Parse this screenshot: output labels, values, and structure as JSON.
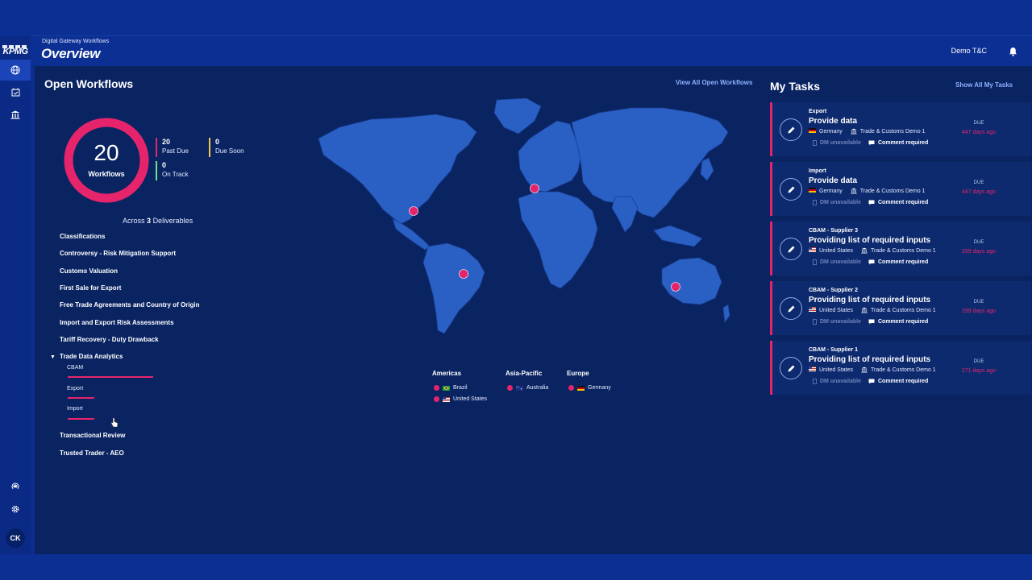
{
  "sidebar": {
    "logo": "KPMG",
    "avatar": "CK",
    "icons": [
      "globe-icon",
      "calendar-check-icon",
      "bank-icon",
      "broadcast-icon",
      "gear-icon"
    ]
  },
  "header": {
    "subtitle": "Digital Gateway Workflows",
    "title": "Overview",
    "user": "Demo T&C"
  },
  "open_workflows": {
    "title": "Open Workflows",
    "view_all": "View All Open Workflows",
    "total": "20",
    "total_label": "Workflows",
    "stats": [
      {
        "num": "20",
        "label": "Past Due",
        "color": "#e6246c"
      },
      {
        "num": "0",
        "label": "Due Soon",
        "color": "#f2c94c"
      },
      {
        "num": "0",
        "label": "On Track",
        "color": "#6fe08a"
      }
    ],
    "across_prefix": "Across",
    "across_count": "3",
    "across_suffix": "Deliverables",
    "deliverables": [
      "Classifications",
      "Controversy - Risk Mitigation Support",
      "Customs Valuation",
      "First Sale for Export",
      "Free Trade Agreements and Country of Origin",
      "Import and Export Risk Assessments",
      "Tariff Recovery - Duty Drawback",
      "Trade Data Analytics",
      "Transactional Review",
      "Trusted Trader - AEO"
    ],
    "sub_items": [
      {
        "label": "CBAM",
        "fraction": 1.0
      },
      {
        "label": "Export",
        "fraction": 0.31
      },
      {
        "label": "Import",
        "fraction": 0.31
      }
    ]
  },
  "legend": {
    "regions": [
      {
        "name": "Americas",
        "countries": [
          "Brazil",
          "United States"
        ]
      },
      {
        "name": "Asia-Pacific",
        "countries": [
          "Australia"
        ]
      },
      {
        "name": "Europe",
        "countries": [
          "Germany"
        ]
      }
    ]
  },
  "my_tasks": {
    "title": "My Tasks",
    "show_all": "Show All My Tasks",
    "due_label": "DUE",
    "dm_label": "DM unavailable",
    "comment_label": "Comment required",
    "items": [
      {
        "category": "Export",
        "title": "Provide data",
        "country": "Germany",
        "flag": "de",
        "org": "Trade & Customs Demo 1",
        "due": "447 days ago"
      },
      {
        "category": "Import",
        "title": "Provide data",
        "country": "Germany",
        "flag": "de",
        "org": "Trade & Customs Demo 1",
        "due": "447 days ago"
      },
      {
        "category": "CBAM - Supplier 3",
        "title": "Providing list of required inputs",
        "country": "United States",
        "flag": "us",
        "org": "Trade & Customs Demo 1",
        "due": "299 days ago"
      },
      {
        "category": "CBAM - Supplier 2",
        "title": "Providing list of required inputs",
        "country": "United States",
        "flag": "us",
        "org": "Trade & Customs Demo 1",
        "due": "299 days ago"
      },
      {
        "category": "CBAM - Supplier 1",
        "title": "Providing list of required inputs",
        "country": "United States",
        "flag": "us",
        "org": "Trade & Customs Demo 1",
        "due": "271 days ago"
      }
    ]
  }
}
